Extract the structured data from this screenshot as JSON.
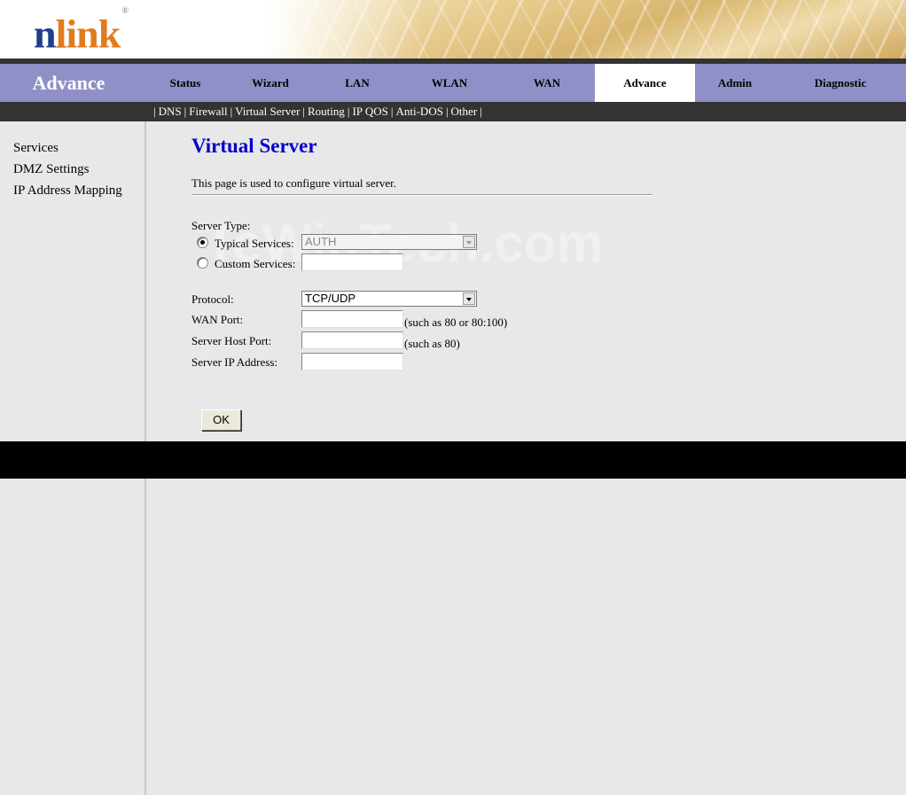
{
  "brand": {
    "logo_n": "n",
    "logo_link": "link",
    "registered": "®"
  },
  "header": {
    "section_title": "Advance"
  },
  "main_tabs": [
    {
      "label": "Status"
    },
    {
      "label": "Wizard"
    },
    {
      "label": "LAN"
    },
    {
      "label": "WLAN"
    },
    {
      "label": "WAN"
    },
    {
      "label": "Advance",
      "active": true
    },
    {
      "label": "Admin"
    },
    {
      "label": "Diagnostic"
    }
  ],
  "sub_tabs": [
    {
      "label": "DNS"
    },
    {
      "label": "Firewall"
    },
    {
      "label": "Virtual Server"
    },
    {
      "label": "Routing"
    },
    {
      "label": "IP QOS"
    },
    {
      "label": "Anti-DOS"
    },
    {
      "label": "Other"
    }
  ],
  "sub_separator": "|",
  "sidebar": {
    "items": [
      {
        "label": "Services"
      },
      {
        "label": "DMZ Settings"
      },
      {
        "label": "IP Address Mapping"
      }
    ]
  },
  "page": {
    "title": "Virtual Server",
    "description": "This page is used to configure virtual server."
  },
  "form": {
    "server_type_label": "Server Type:",
    "typical_services_label": "Typical Services:",
    "typical_services_value": "AUTH",
    "custom_services_label": "Custom Services:",
    "custom_services_value": "",
    "protocol_label": "Protocol:",
    "protocol_value": "TCP/UDP",
    "wan_port_label": "WAN Port:",
    "wan_port_value": "",
    "wan_port_hint": "(such as 80 or 80:100)",
    "server_host_port_label": "Server Host Port:",
    "server_host_port_value": "",
    "server_host_port_hint": "(such as 80)",
    "server_ip_label": "Server IP Address:",
    "server_ip_value": "",
    "ok_label": "OK"
  },
  "watermark": "TeWinTech.com",
  "colors": {
    "nav_bg": "#9090c8",
    "subnav_bg": "#333333",
    "title": "#0000cc",
    "logo_blue": "#1f3f8a",
    "logo_orange": "#e27a1e"
  }
}
